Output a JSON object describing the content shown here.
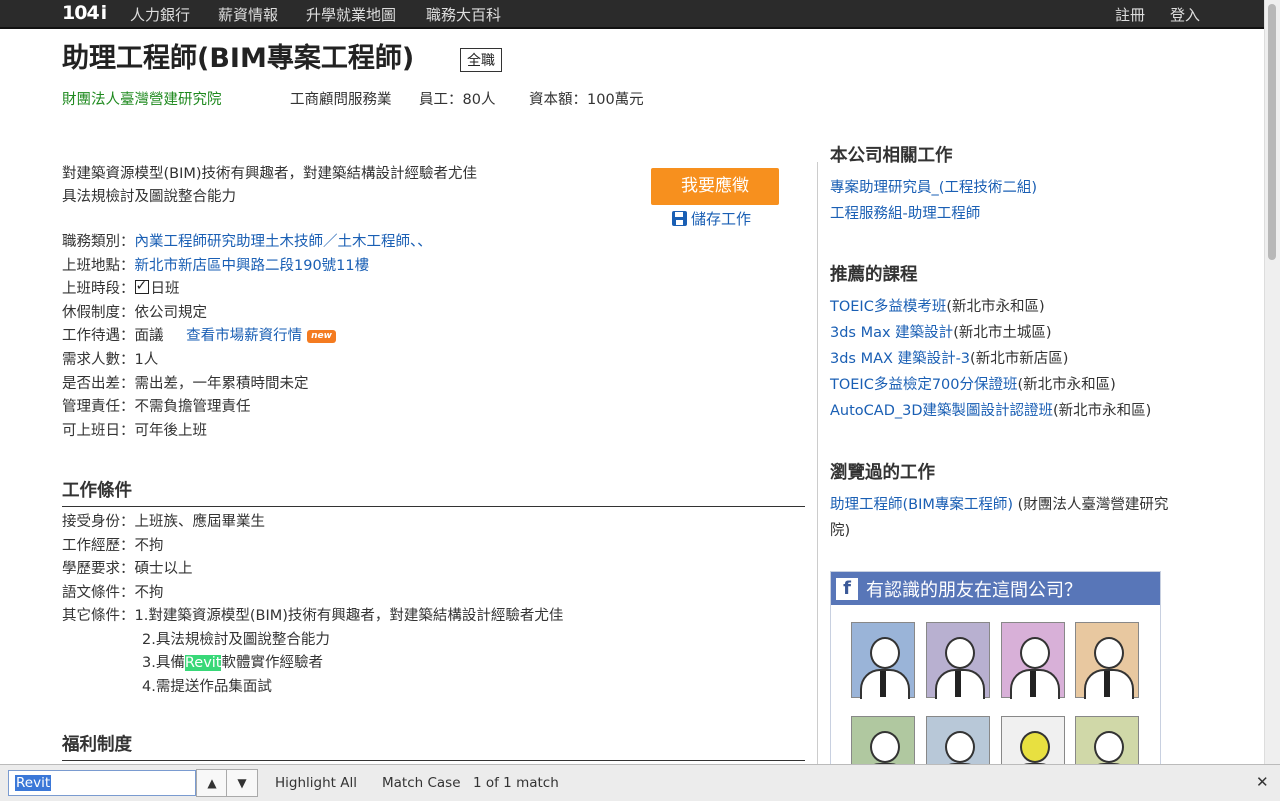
{
  "nav": {
    "logo": "104",
    "logo_i": "i",
    "items": [
      "人力銀行",
      "薪資情報",
      "升學就業地圖",
      "職務大百科"
    ],
    "register": "註冊",
    "login": "登入"
  },
  "job": {
    "title": "助理工程師(BIM專案工程師)",
    "type_badge": "全職",
    "company": "財團法人臺灣營建研究院",
    "industry": "工商顧問服務業",
    "employees": "員工：80人",
    "capital": "資本額：100萬元",
    "intro_1": "對建築資源模型(BIM)技術有興趣者，對建築結構設計經驗者尤佳",
    "intro_2": "具法規檢討及圖說整合能力",
    "apply_label": "我要應徵",
    "save_label": "儲存工作"
  },
  "details": {
    "category_k": "職務類別：",
    "category_v": "內業工程師研究助理土木技師／土木工程師、、",
    "location_k": "上班地點：",
    "location_v": "新北市新店區中興路二段190號11樓",
    "hours_k": "上班時段：",
    "hours_v": "日班",
    "leave_k": "休假制度：",
    "leave_v": "依公司規定",
    "salary_k": "工作待遇：",
    "salary_v": "面議",
    "salary_link": "查看市場薪資行情",
    "new_tag": "new",
    "headcount_k": "需求人數：",
    "headcount_v": "1人",
    "travel_k": "是否出差：",
    "travel_v": "需出差，一年累積時間未定",
    "manage_k": "管理責任：",
    "manage_v": "不需負擔管理責任",
    "start_k": "可上班日：",
    "start_v": "可年後上班"
  },
  "conditions": {
    "heading": "工作條件",
    "identity_k": "接受身份：",
    "identity_v": "上班族、應屆畢業生",
    "exp_k": "工作經歷：",
    "exp_v": "不拘",
    "edu_k": "學歷要求：",
    "edu_v": "碩士以上",
    "lang_k": "語文條件：",
    "lang_v": "不拘",
    "other_k": "其它條件：",
    "other_1": "1.對建築資源模型(BIM)技術有興趣者，對建築結構設計經驗者尤佳",
    "other_2": "2.具法規檢討及圖說整合能力",
    "other_3_pre": "3.具備",
    "other_3_hl": "Revit",
    "other_3_post": "軟體實作經驗者",
    "other_4": "4.需提送作品集面試"
  },
  "benefits": {
    "heading": "福利制度"
  },
  "sidebar": {
    "related_h": "本公司相關工作",
    "related": [
      "專案助理研究員_(工程技術二組)",
      "工程服務組-助理工程師"
    ],
    "courses_h": "推薦的課程",
    "courses": [
      {
        "link": "TOEIC多益模考班",
        "loc": "(新北市永和區)"
      },
      {
        "link": "3ds Max 建築設計",
        "loc": "(新北市土城區)"
      },
      {
        "link": "3ds MAX 建築設計-3",
        "loc": "(新北市新店區)"
      },
      {
        "link": "TOEIC多益檢定700分保證班",
        "loc": "(新北市永和區)"
      },
      {
        "link": "AutoCAD_3D建築製圖設計認證班",
        "loc": "(新北市永和區)"
      }
    ],
    "viewed_h": "瀏覽過的工作",
    "viewed_link": "助理工程師(BIM專案工程師)",
    "viewed_company_1": " (財團法人臺灣營建研究",
    "viewed_company_2": "院)",
    "fb_icon": "f",
    "fb_title": "有認識的朋友在這間公司？"
  },
  "findbar": {
    "query": "Revit",
    "highlight_all": "Highlight All",
    "match_case": "Match Case",
    "status": "1 of 1 match",
    "up_icon": "chevron-up-icon",
    "down_icon": "chevron-down-icon"
  }
}
